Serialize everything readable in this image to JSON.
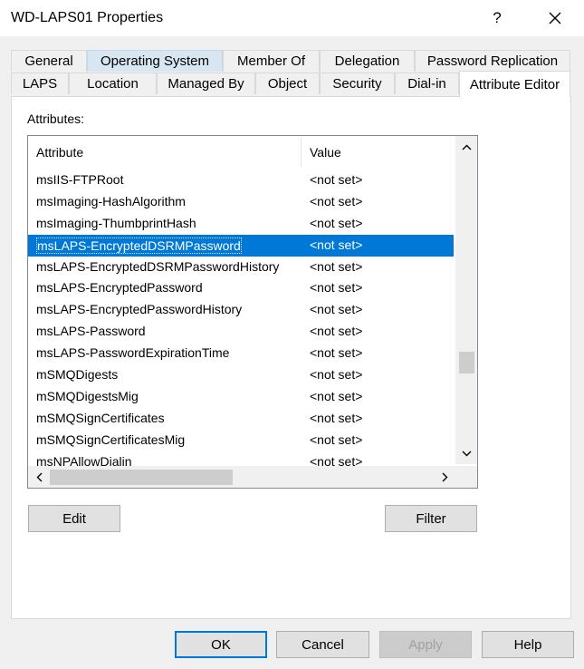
{
  "window": {
    "title": "WD-LAPS01 Properties",
    "help_glyph": "?",
    "close_icon": "close-icon"
  },
  "tabs_row1": [
    {
      "label": "General"
    },
    {
      "label": "Operating System"
    },
    {
      "label": "Member Of"
    },
    {
      "label": "Delegation"
    },
    {
      "label": "Password Replication"
    }
  ],
  "tabs_row2": [
    {
      "label": "LAPS"
    },
    {
      "label": "Location"
    },
    {
      "label": "Managed By"
    },
    {
      "label": "Object"
    },
    {
      "label": "Security"
    },
    {
      "label": "Dial-in"
    },
    {
      "label": "Attribute Editor"
    }
  ],
  "active_tab": "Attribute Editor",
  "attributes_label": "Attributes:",
  "list": {
    "columns": {
      "attribute": "Attribute",
      "value": "Value"
    },
    "rows": [
      {
        "attribute": "msIIS-FTPRoot",
        "value": "<not set>"
      },
      {
        "attribute": "msImaging-HashAlgorithm",
        "value": "<not set>"
      },
      {
        "attribute": "msImaging-ThumbprintHash",
        "value": "<not set>"
      },
      {
        "attribute": "msLAPS-EncryptedDSRMPassword",
        "value": "<not set>",
        "selected": true
      },
      {
        "attribute": "msLAPS-EncryptedDSRMPasswordHistory",
        "value": "<not set>"
      },
      {
        "attribute": "msLAPS-EncryptedPassword",
        "value": "<not set>"
      },
      {
        "attribute": "msLAPS-EncryptedPasswordHistory",
        "value": "<not set>"
      },
      {
        "attribute": "msLAPS-Password",
        "value": "<not set>"
      },
      {
        "attribute": "msLAPS-PasswordExpirationTime",
        "value": "<not set>"
      },
      {
        "attribute": "mSMQDigests",
        "value": "<not set>"
      },
      {
        "attribute": "mSMQDigestsMig",
        "value": "<not set>"
      },
      {
        "attribute": "mSMQSignCertificates",
        "value": "<not set>"
      },
      {
        "attribute": "mSMQSignCertificatesMig",
        "value": "<not set>"
      },
      {
        "attribute": "msNPAllowDialin",
        "value": "<not set>"
      }
    ]
  },
  "buttons": {
    "edit": "Edit",
    "filter": "Filter",
    "ok": "OK",
    "cancel": "Cancel",
    "apply": "Apply",
    "help": "Help"
  },
  "colors": {
    "selection": "#0078d7",
    "default_button_border": "#0078d7"
  }
}
